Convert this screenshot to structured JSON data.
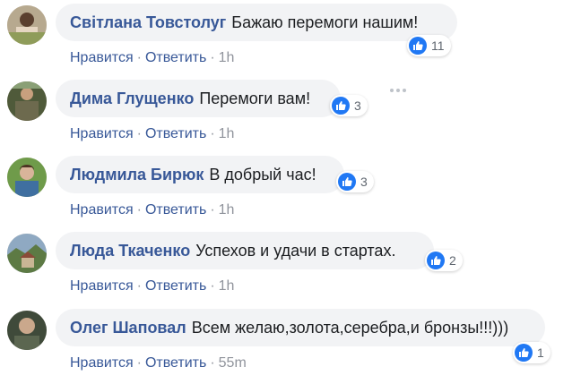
{
  "comments": [
    {
      "author": "Світлана Товстолуг",
      "text": "Бажаю перемоги нашим!",
      "likes": "11",
      "like_label": "Нравится",
      "reply_label": "Ответить",
      "time": "1h"
    },
    {
      "author": "Дима Глущенко",
      "text": "Перемоги вам!",
      "likes": "3",
      "like_label": "Нравится",
      "reply_label": "Ответить",
      "time": "1h"
    },
    {
      "author": "Людмила Бирюк",
      "text": "В добрый час!",
      "likes": "3",
      "like_label": "Нравится",
      "reply_label": "Ответить",
      "time": "1h"
    },
    {
      "author": "Люда Ткаченко",
      "text": "Успехов и удачи в стартах.",
      "likes": "2",
      "like_label": "Нравится",
      "reply_label": "Ответить",
      "time": "1h"
    },
    {
      "author": "Олег Шаповал",
      "text": "Всем желаю,золота,серебра,и бронзы!!!)))",
      "likes": "1",
      "like_label": "Нравится",
      "reply_label": "Ответить",
      "time": "55m"
    }
  ],
  "separator": "·",
  "colors": {
    "author": "#385898",
    "bubble": "#f2f3f5",
    "like_badge": "#2078f4",
    "meta": "#90949c"
  },
  "icons": {
    "reaction": "thumbs-up-icon",
    "more": "more-options-icon"
  }
}
